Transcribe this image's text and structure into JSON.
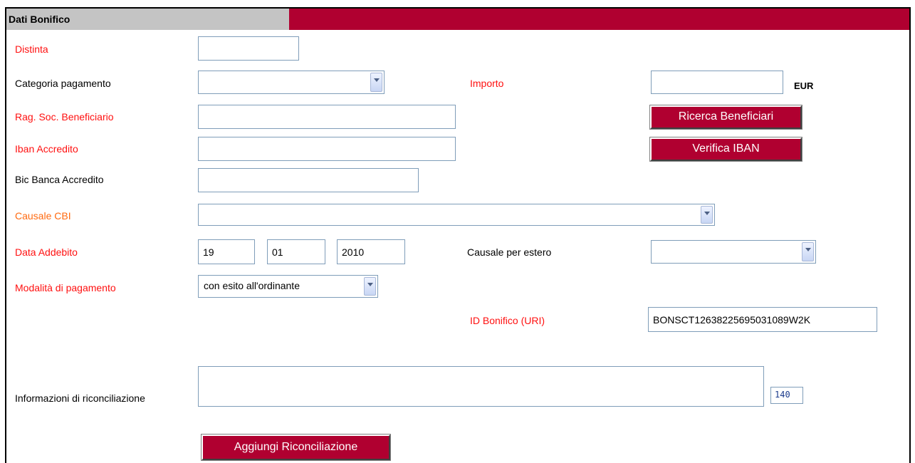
{
  "section": {
    "title": "Dati Bonifico"
  },
  "fields": {
    "distinta": {
      "label": "Distinta",
      "value": ""
    },
    "categoria": {
      "label": "Categoria pagamento",
      "value": ""
    },
    "importo": {
      "label": "Importo",
      "value": "",
      "currency": "EUR"
    },
    "rag_soc": {
      "label": "Rag. Soc. Beneficiario",
      "value": ""
    },
    "iban": {
      "label": "Iban Accredito",
      "value": ""
    },
    "bic": {
      "label": "Bic Banca Accredito",
      "value": ""
    },
    "causale_cbi": {
      "label": "Causale CBI",
      "value": ""
    },
    "data_addebito": {
      "label": "Data Addebito",
      "day": "19",
      "month": "01",
      "year": "2010"
    },
    "causale_estero": {
      "label": "Causale per estero",
      "value": ""
    },
    "modalita": {
      "label": "Modalità di pagamento",
      "value": "con esito all'ordinante"
    },
    "id_bonifico": {
      "label": "ID Bonifico (URI)",
      "value": "BONSCT12638225695031089W2K"
    },
    "riconciliazione": {
      "label": "Informazioni di riconciliazione",
      "value": "",
      "counter": "140"
    }
  },
  "buttons": {
    "ricerca": "Ricerca Beneficiari",
    "verifica": "Verifica IBAN",
    "aggiungi": "Aggiungi Riconciliazione"
  },
  "colors": {
    "accent": "#b00030",
    "label_required": "#ff1010",
    "label_optional": "#ff6a10"
  }
}
